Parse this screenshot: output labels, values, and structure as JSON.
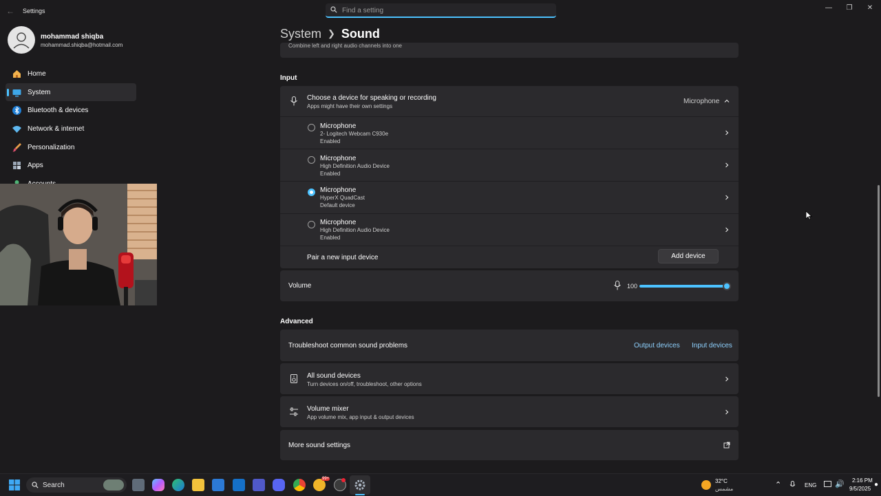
{
  "window": {
    "app_title": "Settings",
    "search_placeholder": "Find a setting"
  },
  "user": {
    "name": "mohammad shiqba",
    "email": "mohammad.shiqba@hotmail.com"
  },
  "nav": [
    {
      "label": "Home",
      "icon": "home-icon"
    },
    {
      "label": "System",
      "icon": "system-icon",
      "active": true
    },
    {
      "label": "Bluetooth & devices",
      "icon": "bluetooth-icon"
    },
    {
      "label": "Network & internet",
      "icon": "wifi-icon"
    },
    {
      "label": "Personalization",
      "icon": "paintbrush-icon"
    },
    {
      "label": "Apps",
      "icon": "apps-icon"
    },
    {
      "label": "Accounts",
      "icon": "accounts-icon"
    }
  ],
  "breadcrumb": {
    "parent": "System",
    "current": "Sound"
  },
  "top_partial_text": "Combine left and right audio channels into one",
  "input_section": {
    "title": "Input",
    "chooser": {
      "title": "Choose a device for speaking or recording",
      "subtitle": "Apps might have their own settings",
      "selected_value": "Microphone"
    },
    "devices": [
      {
        "name": "Microphone",
        "device": "2- Logitech Webcam C930e",
        "status": "Enabled",
        "selected": false
      },
      {
        "name": "Microphone",
        "device": "High Definition Audio Device",
        "status": "Enabled",
        "selected": false
      },
      {
        "name": "Microphone",
        "device": "HyperX QuadCast",
        "status": "Default device",
        "selected": true
      },
      {
        "name": "Microphone",
        "device": "High Definition Audio Device",
        "status": "Enabled",
        "selected": false
      }
    ],
    "pair_label": "Pair a new input device",
    "add_device_button": "Add device",
    "volume_label": "Volume",
    "volume_value": "100",
    "volume_level": 1.0
  },
  "advanced_section": {
    "title": "Advanced",
    "troubleshoot_label": "Troubleshoot common sound problems",
    "output_devices_link": "Output devices",
    "input_devices_link": "Input devices",
    "all_sound_devices": {
      "title": "All sound devices",
      "subtitle": "Turn devices on/off, troubleshoot, other options"
    },
    "volume_mixer": {
      "title": "Volume mixer",
      "subtitle": "App volume mix, app input & output devices"
    },
    "more_sound_settings": "More sound settings"
  },
  "taskbar": {
    "search_label": "Search",
    "weather_temp": "32°C",
    "weather_condition": "مشمس",
    "language": "ENG",
    "time": "2:16 PM",
    "date": "9/5/2025",
    "badge": "99+"
  },
  "colors": {
    "accent": "#4cc2ff",
    "background": "#1c1b1d",
    "card": "#2b2a2d"
  }
}
